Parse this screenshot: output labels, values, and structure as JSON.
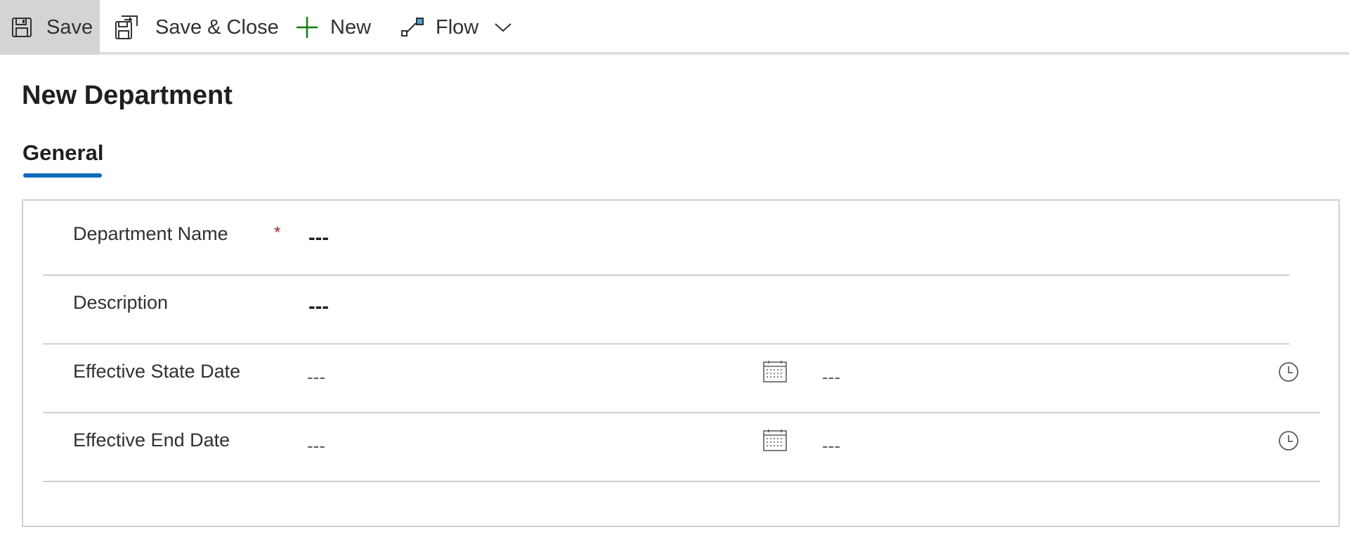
{
  "toolbar": {
    "save_label": "Save",
    "save_close_label": "Save & Close",
    "new_label": "New",
    "flow_label": "Flow"
  },
  "header": {
    "title": "New Department"
  },
  "tabs": [
    {
      "label": "General",
      "selected": true
    }
  ],
  "form": {
    "department_name": {
      "label": "Department Name",
      "required_marker": "*",
      "value": "---"
    },
    "description": {
      "label": "Description",
      "value": "---"
    },
    "effective_start_date": {
      "label": "Effective State Date",
      "date_value": "---",
      "time_value": "---"
    },
    "effective_end_date": {
      "label": "Effective End Date",
      "date_value": "---",
      "time_value": "---"
    }
  },
  "icons": {
    "save": "save-icon",
    "save_close": "save-close-icon",
    "new": "plus-icon",
    "flow": "flow-icon",
    "more": "chevron-down-icon",
    "date": "calendar-icon",
    "time": "clock-icon"
  },
  "colors": {
    "accent": "#0f6cbd",
    "new_icon": "#107c10",
    "required": "#a4262c",
    "save_bg": "#d4d4d4"
  }
}
